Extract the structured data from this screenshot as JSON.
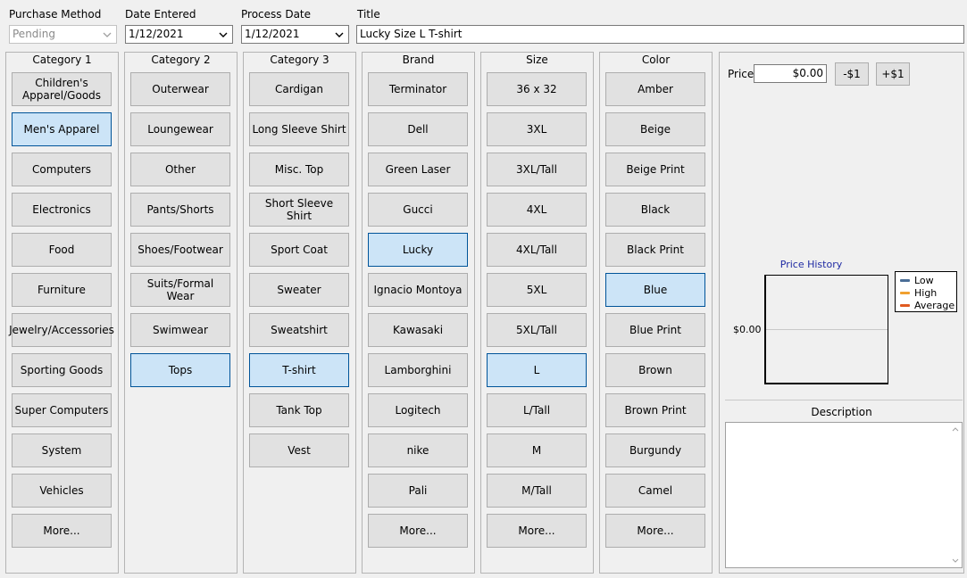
{
  "header": {
    "purchase_method": {
      "label": "Purchase Method",
      "value": "Pending"
    },
    "date_entered": {
      "label": "Date Entered",
      "value": "1/12/2021"
    },
    "process_date": {
      "label": "Process Date",
      "value": "1/12/2021"
    },
    "title": {
      "label": "Title",
      "value": "Lucky Size L T-shirt"
    }
  },
  "columns": [
    {
      "title": "Category 1",
      "options": [
        "Children's Apparel/Goods",
        "Men's Apparel",
        "Computers",
        "Electronics",
        "Food",
        "Furniture",
        "Jewelry/Accessories",
        "Sporting Goods",
        "Super Computers",
        "System",
        "Vehicles",
        "More..."
      ],
      "selected": [
        1
      ]
    },
    {
      "title": "Category 2",
      "options": [
        "Outerwear",
        "Loungewear",
        "Other",
        "Pants/Shorts",
        "Shoes/Footwear",
        "Suits/Formal Wear",
        "Swimwear",
        "Tops"
      ],
      "selected": [
        7
      ]
    },
    {
      "title": "Category 3",
      "options": [
        "Cardigan",
        "Long Sleeve Shirt",
        "Misc. Top",
        "Short Sleeve Shirt",
        "Sport Coat",
        "Sweater",
        "Sweatshirt",
        "T-shirt",
        "Tank Top",
        "Vest"
      ],
      "selected": [
        7
      ]
    },
    {
      "title": "Brand",
      "options": [
        "Terminator",
        "Dell",
        "Green Laser",
        "Gucci",
        "Lucky",
        "Ignacio Montoya",
        "Kawasaki",
        "Lamborghini",
        "Logitech",
        "nike",
        "Pali",
        "More..."
      ],
      "selected": [
        4
      ]
    },
    {
      "title": "Size",
      "options": [
        "36 x 32",
        "3XL",
        "3XL/Tall",
        "4XL",
        "4XL/Tall",
        "5XL",
        "5XL/Tall",
        "L",
        "L/Tall",
        "M",
        "M/Tall",
        "More..."
      ],
      "selected": [
        7
      ]
    },
    {
      "title": "Color",
      "options": [
        "Amber",
        "Beige",
        "Beige Print",
        "Black",
        "Black Print",
        "Blue",
        "Blue Print",
        "Brown",
        "Brown Print",
        "Burgundy",
        "Camel",
        "More..."
      ],
      "selected": [
        5
      ]
    }
  ],
  "price": {
    "label": "Price",
    "value": "$0.00",
    "minus_label": "-$1",
    "plus_label": "+$1"
  },
  "price_history": {
    "title": "Price History",
    "y_tick": "$0.00",
    "legend": [
      {
        "name": "Low",
        "color": "#4a6e96"
      },
      {
        "name": "High",
        "color": "#f0a030"
      },
      {
        "name": "Average",
        "color": "#e05a20"
      }
    ]
  },
  "description": {
    "label": "Description",
    "value": ""
  }
}
